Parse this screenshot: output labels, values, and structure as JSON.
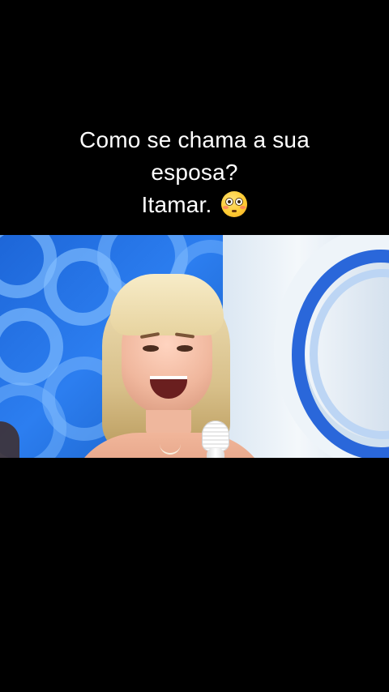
{
  "caption": {
    "lines": [
      "Como se chama a sua",
      "esposa?",
      "Itamar."
    ],
    "emoji": "flushed-face-emoji"
  },
  "video": {
    "content": "video-frame"
  }
}
